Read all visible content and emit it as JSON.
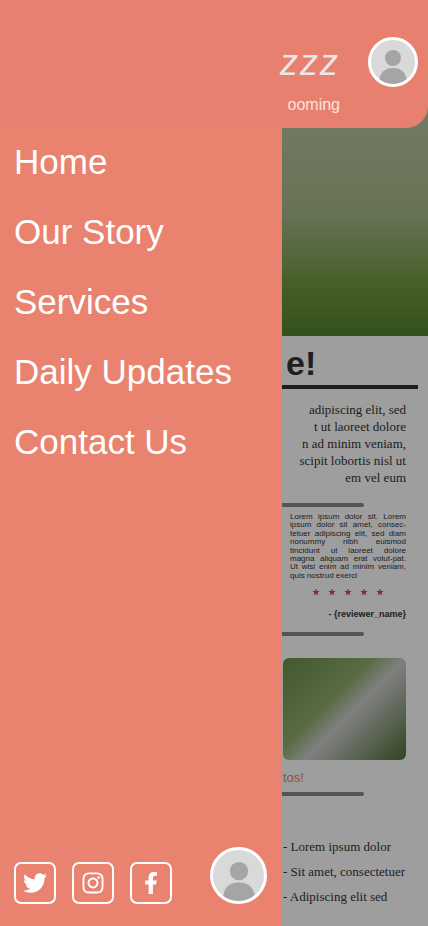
{
  "drawer": {
    "items": [
      {
        "label": "Home"
      },
      {
        "label": "Our Story"
      },
      {
        "label": "Services"
      },
      {
        "label": "Daily Updates"
      },
      {
        "label": "Contact Us"
      }
    ]
  },
  "page": {
    "header": {
      "logo": "zzz",
      "subtitle": "ooming"
    },
    "card": {
      "heading": "e!",
      "paragraph": [
        "adipiscing elit, sed",
        "t ut laoreet dolore",
        "n ad minim veniam,",
        "scipit lobortis nisl ut",
        "em vel eum"
      ],
      "review": {
        "text": "Lorem ipsum dolor sit. Lorem ipsum dolor sit amet, consec-tetuer adipiscing elit, sed diam nonummy nibh euismod tincidunt ut laoreet dolore magna aliquam erat volut-pat. Ut wisi enim ad minim veniam, quis nostrud exerci",
        "stars": 5,
        "reviewer": "- {reviewer_name}"
      },
      "photos_heading": "tos!",
      "list": [
        "- Lorem ipsum dolor",
        "- Sit amet, consectetuer",
        "- Adipiscing elit sed"
      ]
    }
  }
}
